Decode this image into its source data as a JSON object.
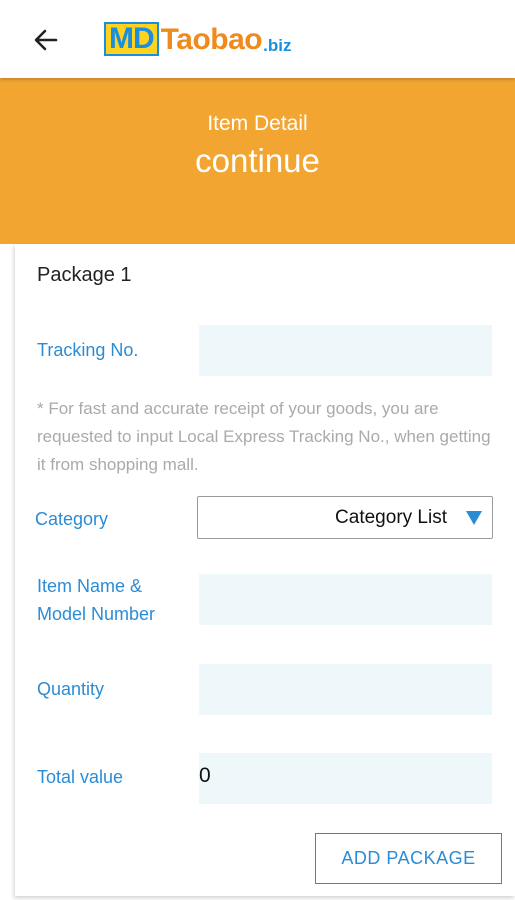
{
  "header": {
    "back_icon": "arrow-left-icon",
    "logo": {
      "part1": "MD",
      "part2": "Taobao",
      "part3": ".biz"
    }
  },
  "banner": {
    "subtitle": "Item Detail",
    "title": "continue",
    "color": "#f2a531"
  },
  "form": {
    "package_title": "Package 1",
    "tracking": {
      "label": "Tracking No.",
      "value": ""
    },
    "hint": "* For fast and accurate receipt of your goods, you are requested to input Local Express Tracking No., when getting it from shopping mall.",
    "category": {
      "label": "Category",
      "selected": "Category List",
      "icon": "triangle-down-icon"
    },
    "item_name": {
      "label_line1": "Item Name &",
      "label_line2": "Model Number",
      "value": ""
    },
    "quantity": {
      "label": "Quantity",
      "value": ""
    },
    "total": {
      "label": "Total value",
      "value": "0"
    },
    "add_button": "ADD PACKAGE"
  },
  "colors": {
    "accent_blue": "#2b8cd6",
    "input_bg": "#eef8fb"
  }
}
